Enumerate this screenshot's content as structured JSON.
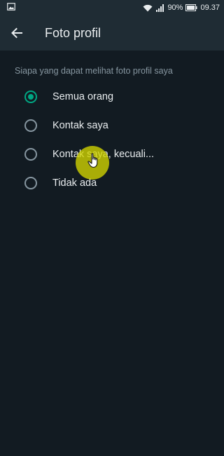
{
  "status_bar": {
    "battery": "90%",
    "time": "09.37",
    "icons": [
      "image-icon",
      "wifi-icon",
      "signal-icon",
      "battery-icon"
    ]
  },
  "app_bar": {
    "back_icon": "arrow-left-icon",
    "title": "Foto profil"
  },
  "section": {
    "label": "Siapa yang dapat melihat foto profil saya"
  },
  "options": [
    {
      "label": "Semua orang",
      "selected": true
    },
    {
      "label": "Kontak saya",
      "selected": false
    },
    {
      "label": "Kontak saya, kecuali...",
      "selected": false
    },
    {
      "label": "Tidak ada",
      "selected": false
    }
  ],
  "colors": {
    "background": "#121b22",
    "app_bar": "#1f2c34",
    "accent": "#00a884",
    "text_primary": "#e9edef",
    "text_secondary": "#8696a0",
    "touch_indicator": "#d4d600"
  }
}
